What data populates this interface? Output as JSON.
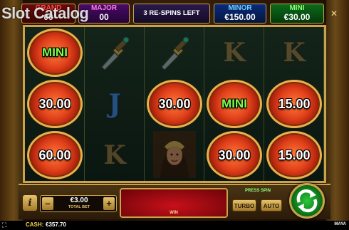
{
  "watermark": "Slot Catalog",
  "jackpots": {
    "grand": {
      "label": "GRAND",
      "value": "00"
    },
    "major": {
      "label": "MAJOR",
      "value": "00"
    },
    "minor": {
      "label": "MINOR",
      "value": "€150.00"
    },
    "mini": {
      "label": "MINI",
      "value": "€30.00"
    }
  },
  "respins_text": "3 RE-SPINS LEFT",
  "close_icon": "✕",
  "reels": [
    [
      {
        "kind": "coin",
        "text": "MINI",
        "green": true
      },
      {
        "kind": "coin",
        "text": "30.00"
      },
      {
        "kind": "coin",
        "text": "60.00"
      }
    ],
    [
      {
        "kind": "dagger"
      },
      {
        "kind": "letter",
        "letter": "J",
        "color": "j"
      },
      {
        "kind": "letter",
        "letter": "K",
        "color": "k"
      }
    ],
    [
      {
        "kind": "dagger"
      },
      {
        "kind": "coin",
        "text": "30.00"
      },
      {
        "kind": "queen"
      }
    ],
    [
      {
        "kind": "letter",
        "letter": "K",
        "color": "k"
      },
      {
        "kind": "coin",
        "text": "MINI",
        "green": true
      },
      {
        "kind": "coin",
        "text": "30.00"
      }
    ],
    [
      {
        "kind": "letter",
        "letter": "K",
        "color": "k"
      },
      {
        "kind": "coin",
        "text": "15.00"
      },
      {
        "kind": "coin",
        "text": "15.00"
      }
    ]
  ],
  "controls": {
    "info_label": "i",
    "minus_label": "–",
    "plus_label": "+",
    "bet_value": "€3.00",
    "bet_label": "TOTAL BET",
    "win_label": "WIN",
    "press_spin": "PRESS SPIN",
    "turbo_label": "TURBO",
    "auto_label": "AUTO"
  },
  "footer": {
    "fullscreen_icon": "⛶",
    "cash_label": "CASH:",
    "cash_value": "€357.70",
    "game_name": "MAYA"
  },
  "colors": {
    "accent_gold": "#c9a24a",
    "coin_red": "#e0401a",
    "mini_green": "#7cff4a"
  }
}
